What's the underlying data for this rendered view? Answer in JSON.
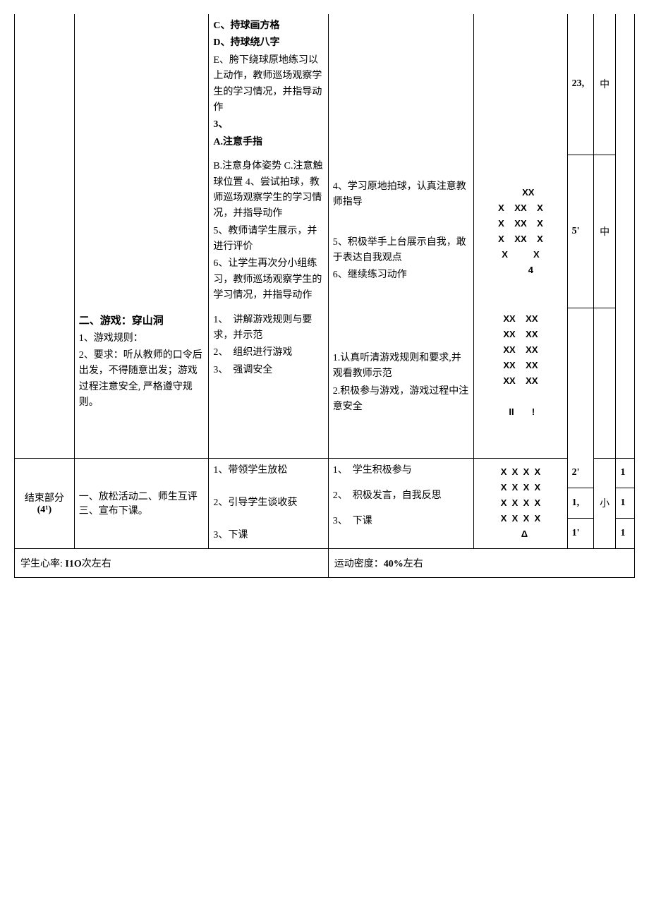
{
  "row1": {
    "colC": {
      "c": "C、持球画方格",
      "d": "D、持球绕八字",
      "e": "E、胯下绕球原地练习以上动作，教师巡场观察学生的学习情况，并指导动作",
      "p3": "3、",
      "a": "A.注意手指"
    },
    "colF": "23,",
    "colG": "中"
  },
  "row2": {
    "colC": {
      "l1": "B.注意身体姿势 C.注意触球位置 4、尝试拍球，教师巡场观察学生的学习情况，并指导动作",
      "l5": "5、教师请学生展示，并进行评价",
      "l6": "6、让学生再次分小组练习，教师巡场观察学生的学习情况，并指导动作"
    },
    "colD": {
      "p4": "4、学习原地拍球，认真注意教师指导",
      "p5": "5、积极举手上台展示自我，敢于表达自我观点",
      "p6": "6、继续练习动作"
    },
    "diagram1": "      XX\nX    XX    X\nX    XX    X\nX    XX    X\nX          X\n        4",
    "colF": "5'",
    "colG": "中"
  },
  "row3": {
    "colB": {
      "title": "二、游戏：穿山洞",
      "p1": "1、游戏规则：",
      "p2": "2、要求：听从教师的口令后出发，不得随意出发；游戏过程注意安全, 严格遵守规则。"
    },
    "colC": {
      "p1": "1、　讲解游戏规则与要求，并示范",
      "p2": "2、　组织进行游戏",
      "p3": "3、　强调安全"
    },
    "colD": {
      "p1": "1.认真听清游戏规则和要求,并观看教师示范",
      "p2": "2.积极参与游戏，游戏过程中注意安全"
    },
    "diagram2": "XX    XX\nXX    XX\nXX    XX\nXX    XX\nXX    XX\n\n II       !"
  },
  "row4": {
    "colA": {
      "l1": "结束部分",
      "l2": "(4¹)"
    },
    "colB": "一、放松活动二、师生互评三、宣布下课。",
    "colC": {
      "p1": "1、带领学生放松",
      "p2": "2、引导学生谈收获",
      "p3": "3、下课"
    },
    "colD": {
      "p1": "1、　学生积极参与",
      "p2": "2、　积极发言，自我反思",
      "p3": "3、　下课"
    },
    "diagram3": "X  X  X  X\nX  X  X  X\nX  X  X  X\nX  X  X  X\n   Δ",
    "colF": {
      "a": "2'",
      "b": "1,",
      "c": "1'"
    },
    "colG": "小",
    "colH": {
      "a": "1",
      "b": "1",
      "c": "1"
    }
  },
  "footer": {
    "left_label": "学生心率: ",
    "left_value": "I1O",
    "left_suffix": "次左右",
    "right_label": "运动密度：",
    "right_value": "40%",
    "right_suffix": "左右"
  }
}
